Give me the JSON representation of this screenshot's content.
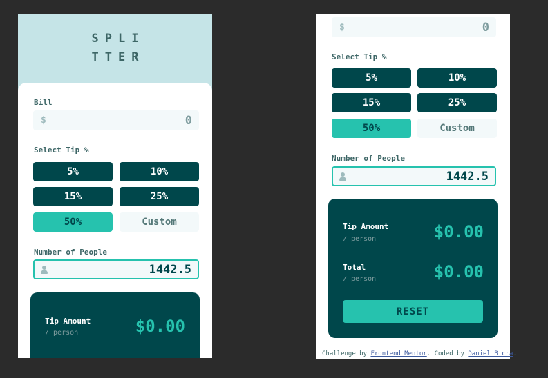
{
  "app": {
    "logo_line1": "SPLI",
    "logo_line2": "TTER"
  },
  "bill": {
    "label": "Bill",
    "icon": "dollar-icon",
    "symbol": "$",
    "value": "0"
  },
  "tip": {
    "label": "Select Tip %",
    "options": [
      "5%",
      "10%",
      "15%",
      "25%",
      "50%"
    ],
    "selected": "50%",
    "custom_placeholder": "Custom"
  },
  "people": {
    "label": "Number of People",
    "icon": "person-icon",
    "value": "1442.5"
  },
  "results": {
    "tip_label": "Tip Amount",
    "tip_sub": "/ person",
    "tip_value": "$0.00",
    "total_label": "Total",
    "total_sub": "/ person",
    "total_value": "$0.00",
    "reset_label": "RESET"
  },
  "attribution": {
    "prefix": "Challenge by ",
    "challenge_link": "Frontend Mentor",
    "middle": ". Coded by ",
    "author_link": "Daniel Bicra",
    "suffix": "."
  },
  "colors": {
    "background": "#2b2b2b",
    "header_bg": "#c5e4e7",
    "dark_cyan": "#00474b",
    "strong_cyan": "#26c2ae",
    "input_bg": "#f3f9fa"
  }
}
